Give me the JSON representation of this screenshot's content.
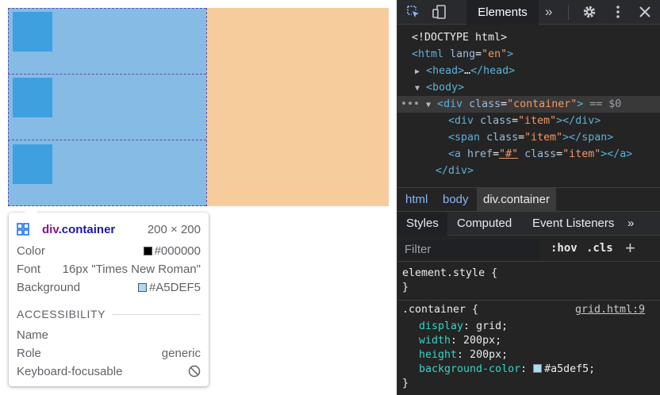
{
  "page": {
    "tooltip": {
      "element_tag": "div",
      "element_class": ".container",
      "size": "200 × 200",
      "rows": [
        {
          "label": "Color",
          "value": "#000000",
          "swatch": "#000000"
        },
        {
          "label": "Font",
          "value": "16px \"Times New Roman\""
        },
        {
          "label": "Background",
          "value": "#A5DEF5",
          "swatch": "#A5DEF5"
        }
      ],
      "accessibility_heading": "ACCESSIBILITY",
      "accessibility_rows": [
        {
          "label": "Name",
          "value": ""
        },
        {
          "label": "Role",
          "value": "generic"
        },
        {
          "label": "Keyboard-focusable",
          "value": ""
        }
      ]
    },
    "colors": {
      "grid_area": "#86bbe6",
      "margin_area": "#f7cc9c",
      "item": "#3ea0df"
    }
  },
  "devtools": {
    "tabs": {
      "active": "Elements",
      "more": "»"
    },
    "icons": [
      "inspect-element-icon",
      "device-toolbar-icon",
      "settings-gear-icon",
      "kebab-menu-icon",
      "close-icon"
    ],
    "dom": {
      "doctype": "<!DOCTYPE html>",
      "html_open_tag": "html",
      "html_attr": "lang",
      "html_attr_val": "\"en\"",
      "head": "head",
      "head_ellipsis": "…",
      "body": "body",
      "container_tag": "div",
      "container_attr": "class",
      "container_val": "\"container\"",
      "selected_suffix": "== $0",
      "selected_dots": "•••",
      "child1_tag": "div",
      "child1_attr": "class",
      "child1_val": "\"item\"",
      "child2_tag": "span",
      "child2_attr": "class",
      "child2_val": "\"item\"",
      "child3_tag": "a",
      "child3_attr1": "href",
      "child3_val1": "\"#\"",
      "child3_attr2": "class",
      "child3_val2": "\"item\"",
      "close_div": "</div>"
    },
    "breadcrumbs": [
      "html",
      "body",
      "div.container"
    ],
    "subtabs": [
      "Styles",
      "Computed",
      "Event Listeners",
      "»"
    ],
    "filter": {
      "placeholder": "Filter",
      "hov": ":hov",
      "cls": ".cls",
      "plus": "+"
    },
    "rules": {
      "element_style": {
        "selector": "element.style {",
        "close": "}"
      },
      "container": {
        "selector": ".container {",
        "source": "grid.html:9",
        "declarations": [
          {
            "prop": "display",
            "value": "grid;"
          },
          {
            "prop": "width",
            "value": "200px;"
          },
          {
            "prop": "height",
            "value": "200px;"
          },
          {
            "prop": "background-color",
            "value": "#a5def5;",
            "swatch": "#a5def5"
          }
        ],
        "close": "}"
      }
    }
  }
}
